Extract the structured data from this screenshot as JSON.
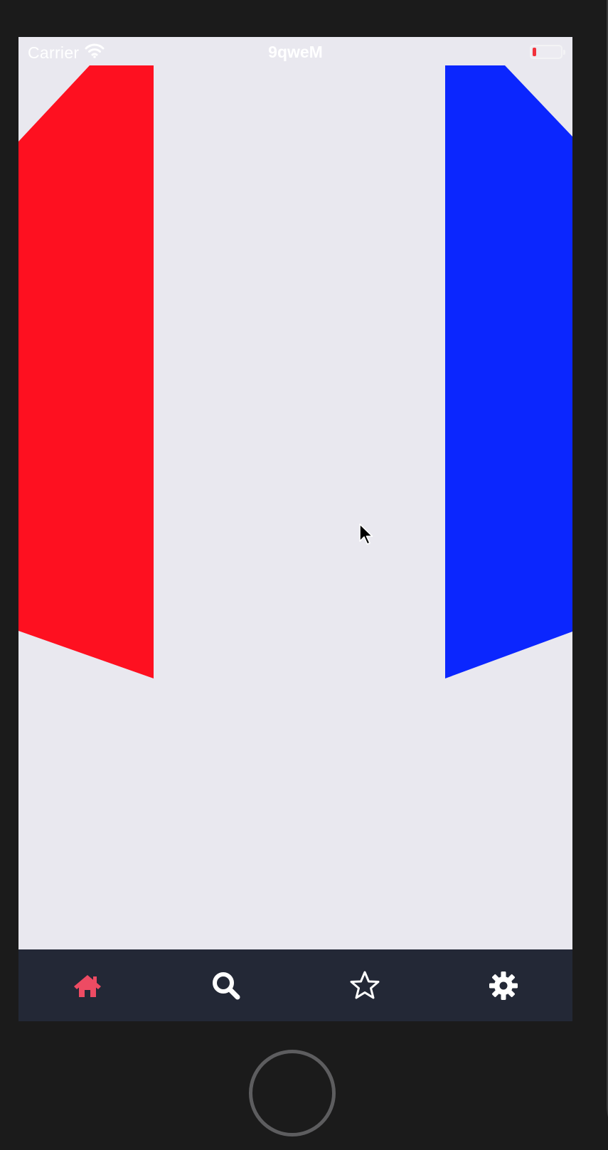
{
  "status_bar": {
    "carrier": "Carrier",
    "time": "9qweM",
    "wifi_icon": "wifi-icon",
    "battery_icon": "battery-low-icon",
    "battery_level": 0.12
  },
  "colors": {
    "screen_background": "#e9e8ef",
    "left_ribbon": "#fe1020",
    "right_ribbon": "#0b26fe",
    "tab_bar_background": "#232836",
    "tab_active": "#ed4b63",
    "tab_inactive": "#ffffff",
    "device_bezel": "#1b1b1b"
  },
  "tab_bar": {
    "active_index": 0,
    "tabs": [
      {
        "icon": "home-icon"
      },
      {
        "icon": "search-icon"
      },
      {
        "icon": "star-icon"
      },
      {
        "icon": "gear-icon"
      }
    ]
  }
}
